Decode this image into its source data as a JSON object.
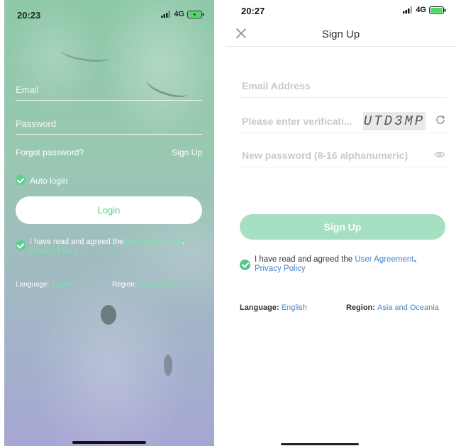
{
  "colors": {
    "brand_green": "#5bcc8a",
    "link_green": "#79e0a9",
    "link_blue": "#4a82c4",
    "disabled_button": "#a6dfc1"
  },
  "login": {
    "status": {
      "time": "20:23",
      "network": "4G"
    },
    "email_placeholder": "Email",
    "password_placeholder": "Password",
    "forgot_password": "Forgot password?",
    "sign_up_link": "Sign Up",
    "auto_login": "Auto login",
    "login_button": "Login",
    "agreement": {
      "prefix": "I have read and agreed the ",
      "user_agreement": "User Agreement",
      "separator": "、",
      "privacy_policy": "Privacy Policy"
    },
    "footer": {
      "language_label": "Language:",
      "language_value": "English",
      "region_label": "Region:",
      "region_value": "Asia and Oceania"
    }
  },
  "signup": {
    "status": {
      "time": "20:27",
      "network": "4G"
    },
    "title": "Sign Up",
    "email_placeholder": "Email Address",
    "verification_placeholder": "Please enter verificati...",
    "captcha_text": "UTD3MP",
    "password_placeholder": "New password (8-16 alphanumeric)",
    "sign_up_button": "Sign Up",
    "agreement": {
      "prefix": "I have read and agreed the ",
      "user_agreement": "User Agreement",
      "separator": "、",
      "privacy_policy": "Privacy Policy"
    },
    "footer": {
      "language_label": "Language:",
      "language_value": "English",
      "region_label": "Region:",
      "region_value": "Asia and Oceania"
    }
  }
}
